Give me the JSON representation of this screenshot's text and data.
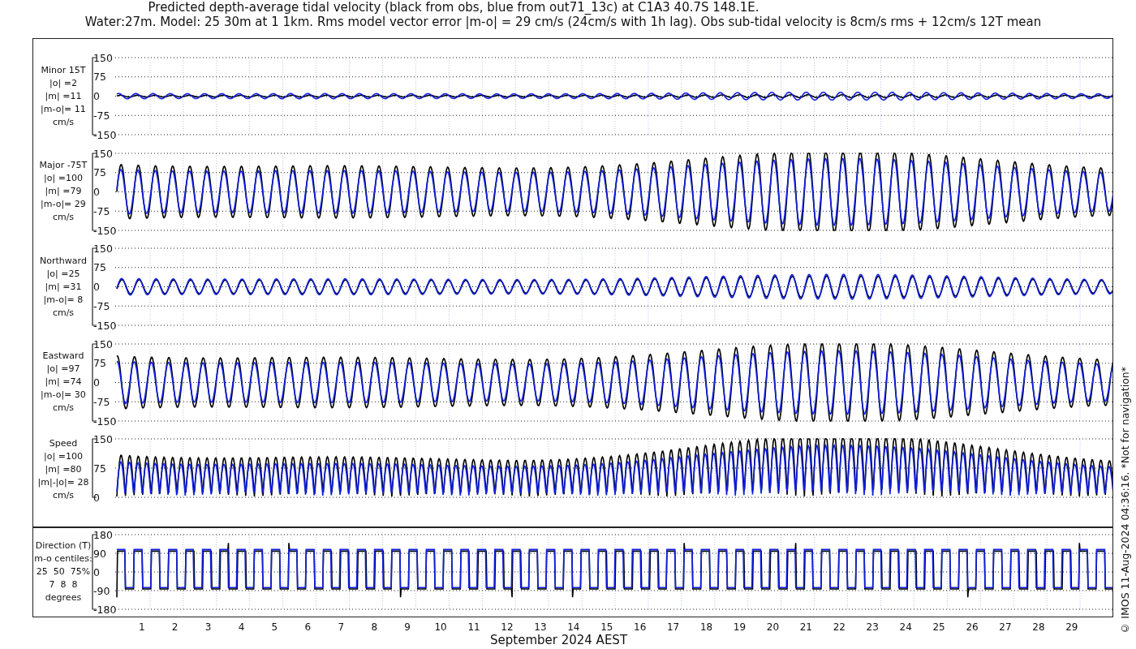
{
  "title_lines": [
    "Predicted depth-average tidal velocity (black from obs, blue from out71_13c) at C1A3 40.7S 148.1E.",
    "Water:27m. Model: 25 30m at 1 1km. Rms model vector error |m-o| = 29 cm/s (24cm/s with 1h lag). Obs sub-tidal velocity is 8cm/s rms + 12cm/s 12T mean"
  ],
  "panels": [
    {
      "kind": "velocity",
      "label_lines": [
        "Minor 15T",
        "|o| =2",
        "|m| =11",
        "|m-o|= 11",
        "cm/s"
      ],
      "yticks": [
        "150",
        "75",
        "0",
        "-75",
        "-150"
      ]
    },
    {
      "kind": "velocity",
      "label_lines": [
        "Major -75T",
        "|o| =100",
        "|m| =79",
        "|m-o|= 29",
        "cm/s"
      ],
      "yticks": [
        "150",
        "75",
        "0",
        "-75",
        "-150"
      ]
    },
    {
      "kind": "velocity",
      "label_lines": [
        "Northward",
        "|o| =25",
        "|m| =31",
        "|m-o|= 8",
        "cm/s"
      ],
      "yticks": [
        "150",
        "75",
        "0",
        "-75",
        "-150"
      ]
    },
    {
      "kind": "velocity",
      "label_lines": [
        "Eastward",
        "|o| =97",
        "|m| =74",
        "|m-o|= 30",
        "cm/s"
      ],
      "yticks": [
        "150",
        "75",
        "0",
        "-75",
        "-150"
      ]
    },
    {
      "kind": "speed",
      "label_lines": [
        "Speed",
        "|o| =100",
        "|m| =80",
        "|m|-|o|= 28",
        "cm/s"
      ],
      "yticks": [
        "150",
        "75",
        "0"
      ]
    },
    {
      "kind": "direction",
      "label_lines": [
        "Direction (T)",
        "m-o centiles:",
        "25  50  75%",
        "7  8  8",
        "degrees"
      ],
      "yticks": [
        "180",
        "90",
        "0",
        "-90",
        "-180"
      ]
    }
  ],
  "x_ticks": [
    "1",
    "2",
    "3",
    "4",
    "5",
    "6",
    "7",
    "8",
    "9",
    "10",
    "11",
    "12",
    "13",
    "14",
    "15",
    "16",
    "17",
    "18",
    "19",
    "20",
    "21",
    "22",
    "23",
    "24",
    "25",
    "26",
    "27",
    "28",
    "29"
  ],
  "x_label": "September 2024 AEST",
  "footer_note": "© IMOS 11-Aug-2024 04:36:16. *Not for navigation*"
}
